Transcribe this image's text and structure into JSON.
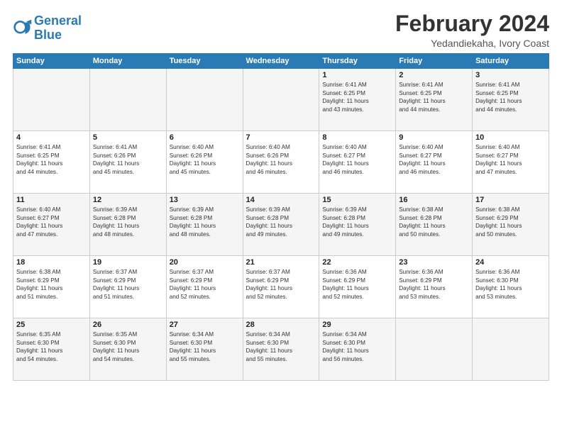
{
  "logo": {
    "line1": "General",
    "line2": "Blue"
  },
  "title": "February 2024",
  "location": "Yedandiekaha, Ivory Coast",
  "days_of_week": [
    "Sunday",
    "Monday",
    "Tuesday",
    "Wednesday",
    "Thursday",
    "Friday",
    "Saturday"
  ],
  "weeks": [
    [
      {
        "day": "",
        "info": ""
      },
      {
        "day": "",
        "info": ""
      },
      {
        "day": "",
        "info": ""
      },
      {
        "day": "",
        "info": ""
      },
      {
        "day": "1",
        "info": "Sunrise: 6:41 AM\nSunset: 6:25 PM\nDaylight: 11 hours\nand 43 minutes."
      },
      {
        "day": "2",
        "info": "Sunrise: 6:41 AM\nSunset: 6:25 PM\nDaylight: 11 hours\nand 44 minutes."
      },
      {
        "day": "3",
        "info": "Sunrise: 6:41 AM\nSunset: 6:25 PM\nDaylight: 11 hours\nand 44 minutes."
      }
    ],
    [
      {
        "day": "4",
        "info": "Sunrise: 6:41 AM\nSunset: 6:25 PM\nDaylight: 11 hours\nand 44 minutes."
      },
      {
        "day": "5",
        "info": "Sunrise: 6:41 AM\nSunset: 6:26 PM\nDaylight: 11 hours\nand 45 minutes."
      },
      {
        "day": "6",
        "info": "Sunrise: 6:40 AM\nSunset: 6:26 PM\nDaylight: 11 hours\nand 45 minutes."
      },
      {
        "day": "7",
        "info": "Sunrise: 6:40 AM\nSunset: 6:26 PM\nDaylight: 11 hours\nand 46 minutes."
      },
      {
        "day": "8",
        "info": "Sunrise: 6:40 AM\nSunset: 6:27 PM\nDaylight: 11 hours\nand 46 minutes."
      },
      {
        "day": "9",
        "info": "Sunrise: 6:40 AM\nSunset: 6:27 PM\nDaylight: 11 hours\nand 46 minutes."
      },
      {
        "day": "10",
        "info": "Sunrise: 6:40 AM\nSunset: 6:27 PM\nDaylight: 11 hours\nand 47 minutes."
      }
    ],
    [
      {
        "day": "11",
        "info": "Sunrise: 6:40 AM\nSunset: 6:27 PM\nDaylight: 11 hours\nand 47 minutes."
      },
      {
        "day": "12",
        "info": "Sunrise: 6:39 AM\nSunset: 6:28 PM\nDaylight: 11 hours\nand 48 minutes."
      },
      {
        "day": "13",
        "info": "Sunrise: 6:39 AM\nSunset: 6:28 PM\nDaylight: 11 hours\nand 48 minutes."
      },
      {
        "day": "14",
        "info": "Sunrise: 6:39 AM\nSunset: 6:28 PM\nDaylight: 11 hours\nand 49 minutes."
      },
      {
        "day": "15",
        "info": "Sunrise: 6:39 AM\nSunset: 6:28 PM\nDaylight: 11 hours\nand 49 minutes."
      },
      {
        "day": "16",
        "info": "Sunrise: 6:38 AM\nSunset: 6:28 PM\nDaylight: 11 hours\nand 50 minutes."
      },
      {
        "day": "17",
        "info": "Sunrise: 6:38 AM\nSunset: 6:29 PM\nDaylight: 11 hours\nand 50 minutes."
      }
    ],
    [
      {
        "day": "18",
        "info": "Sunrise: 6:38 AM\nSunset: 6:29 PM\nDaylight: 11 hours\nand 51 minutes."
      },
      {
        "day": "19",
        "info": "Sunrise: 6:37 AM\nSunset: 6:29 PM\nDaylight: 11 hours\nand 51 minutes."
      },
      {
        "day": "20",
        "info": "Sunrise: 6:37 AM\nSunset: 6:29 PM\nDaylight: 11 hours\nand 52 minutes."
      },
      {
        "day": "21",
        "info": "Sunrise: 6:37 AM\nSunset: 6:29 PM\nDaylight: 11 hours\nand 52 minutes."
      },
      {
        "day": "22",
        "info": "Sunrise: 6:36 AM\nSunset: 6:29 PM\nDaylight: 11 hours\nand 52 minutes."
      },
      {
        "day": "23",
        "info": "Sunrise: 6:36 AM\nSunset: 6:29 PM\nDaylight: 11 hours\nand 53 minutes."
      },
      {
        "day": "24",
        "info": "Sunrise: 6:36 AM\nSunset: 6:30 PM\nDaylight: 11 hours\nand 53 minutes."
      }
    ],
    [
      {
        "day": "25",
        "info": "Sunrise: 6:35 AM\nSunset: 6:30 PM\nDaylight: 11 hours\nand 54 minutes."
      },
      {
        "day": "26",
        "info": "Sunrise: 6:35 AM\nSunset: 6:30 PM\nDaylight: 11 hours\nand 54 minutes."
      },
      {
        "day": "27",
        "info": "Sunrise: 6:34 AM\nSunset: 6:30 PM\nDaylight: 11 hours\nand 55 minutes."
      },
      {
        "day": "28",
        "info": "Sunrise: 6:34 AM\nSunset: 6:30 PM\nDaylight: 11 hours\nand 55 minutes."
      },
      {
        "day": "29",
        "info": "Sunrise: 6:34 AM\nSunset: 6:30 PM\nDaylight: 11 hours\nand 56 minutes."
      },
      {
        "day": "",
        "info": ""
      },
      {
        "day": "",
        "info": ""
      }
    ]
  ]
}
